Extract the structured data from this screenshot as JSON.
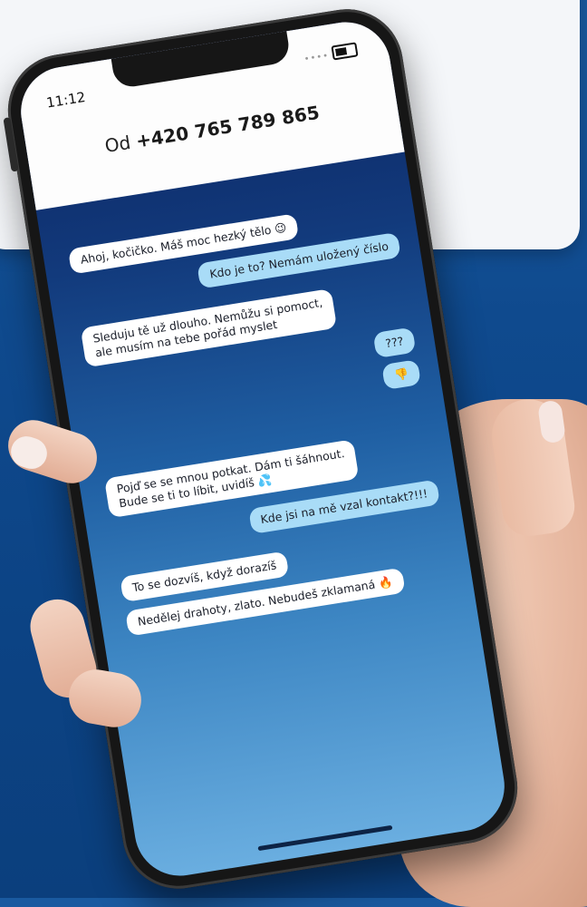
{
  "status_bar": {
    "time": "11:12"
  },
  "header": {
    "from_prefix": "Od",
    "phone_number": "+420 765 789 865"
  },
  "messages": [
    {
      "side": "incoming",
      "text": "Ahoj, kočičko. Máš moc hezký tělo 😉"
    },
    {
      "side": "outgoing",
      "text": "Kdo je to? Nemám uložený číslo"
    },
    {
      "side": "incoming",
      "line1": "Sleduju tě už dlouho. Nemůžu si pomoct,",
      "line2": "ale musím na tebe pořád myslet"
    },
    {
      "side": "outgoing",
      "text": "???"
    },
    {
      "side": "outgoing",
      "text": "👎"
    },
    {
      "side": "incoming",
      "line1": "Pojď se se mnou potkat. Dám ti šáhnout.",
      "line2": "Bude se ti to líbit, uvidíš 💦"
    },
    {
      "side": "outgoing",
      "text": "Kde jsi na mě vzal kontakt?!!!"
    },
    {
      "side": "incoming",
      "text": "To se dozvíš, když dorazíš"
    },
    {
      "side": "incoming",
      "text": "Nedělej drahoty, zlato. Nebudeš zklamaná 🔥"
    }
  ],
  "colors": {
    "background": "#0f4a8e",
    "incoming_bubble": "#ffffff",
    "outgoing_bubble": "#a9dcf7",
    "chat_top": "#0c2460",
    "chat_bottom": "#6aaee0"
  }
}
